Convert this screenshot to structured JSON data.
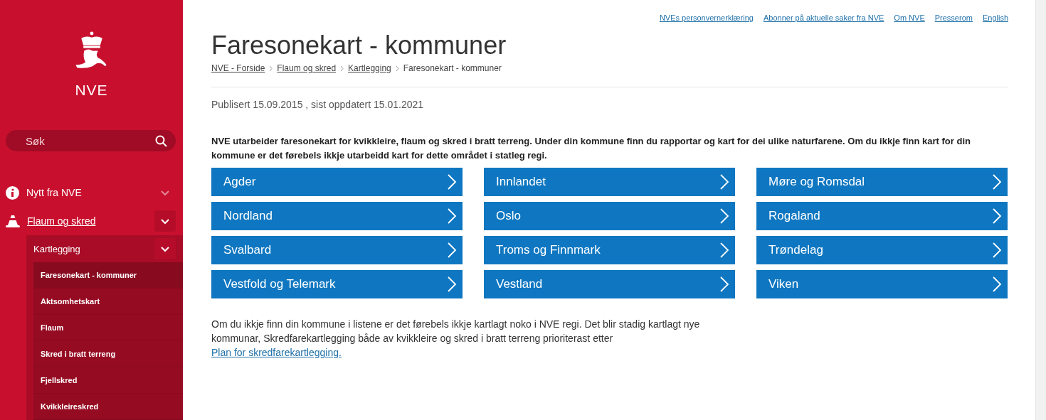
{
  "sidebar": {
    "logo_text": "NVE",
    "search": {
      "placeholder": "Søk"
    },
    "nav": [
      {
        "label": "Nytt fra NVE",
        "expanded": false,
        "selected": false
      },
      {
        "label": "Flaum og skred",
        "expanded": true,
        "selected": true,
        "children": [
          {
            "label": "Kartlegging",
            "expanded": true,
            "children": [
              {
                "label": "Faresonekart - kommuner",
                "selected": true
              },
              {
                "label": "Aktsomhetskart",
                "selected": false
              },
              {
                "label": "Flaum",
                "selected": false
              },
              {
                "label": "Skred i bratt terreng",
                "selected": false
              },
              {
                "label": "Fjellskred",
                "selected": false
              },
              {
                "label": "Kvikkleireskred",
                "selected": false
              }
            ]
          }
        ]
      }
    ]
  },
  "top_links": [
    "NVEs personvernerklæring",
    "Abonner på aktuelle saker fra NVE",
    "Om NVE",
    "Presserom",
    "English"
  ],
  "title": "Faresonekart - kommuner",
  "breadcrumb": {
    "links": [
      "NVE - Forside",
      "Flaum og skred",
      "Kartlegging"
    ],
    "current": "Faresonekart - kommuner"
  },
  "published": "Publisert 15.09.2015 , sist oppdatert 15.01.2021",
  "intro": "NVE utarbeider faresonekart for kvikkleire, flaum og skred i bratt terreng. Under din kommune finn du rapportar og kart for dei ulike naturfarene. Om du ikkje finn kart for din kommune er det førebels ikkje utarbeidd kart for dette området i statleg regi.",
  "regions": [
    "Agder",
    "Innlandet",
    "Møre og Romsdal",
    "Nordland",
    "Oslo",
    "Rogaland",
    "Svalbard",
    "Troms og Finnmark",
    "Trøndelag",
    "Vestfold og Telemark",
    "Vestland",
    "Viken"
  ],
  "footer_text": "Om du ikkje finn din kommune i listene er det førebels ikkje kartlagt noko i NVE regi. Det blir stadig kartlagt nye kommunar, Skredfarekartlegging både av kvikkleire og skred i bratt terreng prioriterast etter",
  "footer_link": "Plan for skredfarekartlegging."
}
